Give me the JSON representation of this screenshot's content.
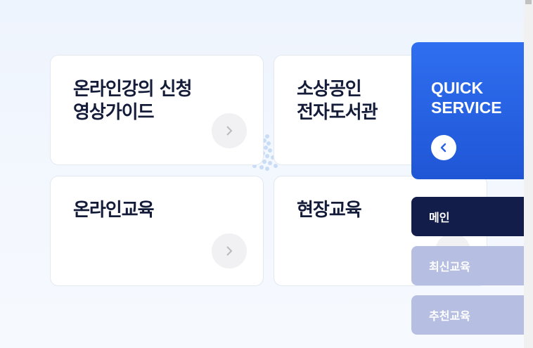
{
  "cards": [
    {
      "title": "온라인강의 신청\n영상가이드",
      "arrow_icon": "chevron-right-icon"
    },
    {
      "title": "소상공인\n전자도서관",
      "arrow_icon": "chevron-right-icon"
    },
    {
      "title": "온라인교육",
      "arrow_icon": "chevron-right-icon"
    },
    {
      "title": "현장교육",
      "arrow_icon": "chevron-right-icon"
    }
  ],
  "quick_service": {
    "title": "QUICK\nSERVICE",
    "toggle_icon": "chevron-left-icon",
    "items": [
      {
        "label": "메인",
        "active": true
      },
      {
        "label": "최신교육",
        "active": false
      },
      {
        "label": "추천교육",
        "active": false
      }
    ]
  },
  "colors": {
    "card_title": "#141c3a",
    "qs_blue": "#2f6ff0",
    "qs_active": "#131d4a",
    "qs_inactive": "#b6bfe2"
  }
}
